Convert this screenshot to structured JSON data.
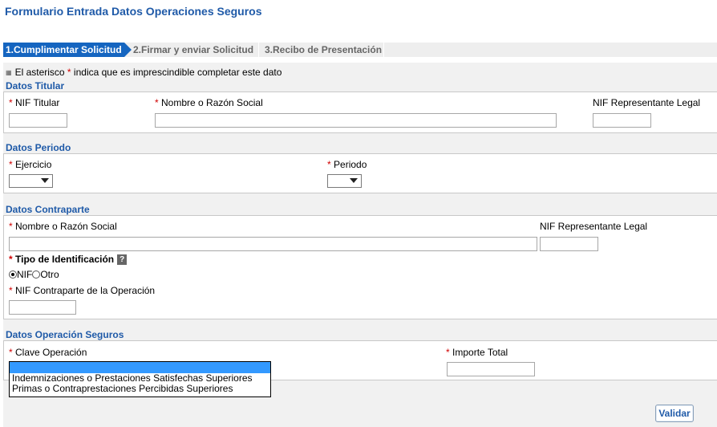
{
  "page": {
    "title": "Formulario Entrada Datos Operaciones Seguros"
  },
  "steps": [
    {
      "label": "1.Cumplimentar Solicitud",
      "active": true
    },
    {
      "label": "2.Firmar y enviar Solicitud",
      "active": false
    },
    {
      "label": "3.Recibo de Presentación",
      "active": false
    }
  ],
  "notice": {
    "prefix": "El asterisco ",
    "asterisk": "*",
    "suffix": " indica que es imprescindible completar este dato"
  },
  "titular": {
    "heading": "Datos Titular",
    "nif_label": "NIF Titular",
    "nombre_label": "Nombre o Razón Social",
    "rep_label": "NIF Representante Legal",
    "nif_value": "",
    "nombre_value": "",
    "rep_value": ""
  },
  "periodo": {
    "heading": "Datos Periodo",
    "ejercicio_label": "Ejercicio",
    "periodo_label": "Periodo",
    "ejercicio_value": "",
    "periodo_value": ""
  },
  "contraparte": {
    "heading": "Datos Contraparte",
    "nombre_label": "Nombre o Razón Social",
    "rep_label": "NIF Representante Legal",
    "tipo_label": "Tipo de Identificación",
    "help_glyph": "?",
    "radio_nif": "NIF",
    "radio_otro": "Otro",
    "selected": "NIF",
    "nif_op_label": "NIF Contraparte de la Operación"
  },
  "operacion": {
    "heading": "Datos Operación Seguros",
    "clave_label": "Clave Operación",
    "importe_label": "Importe Total",
    "options": [
      "Indemnizaciones o Prestaciones Satisfechas Superiores",
      "Primas o Contraprestaciones Percibidas Superiores"
    ]
  },
  "actions": {
    "validar_label": "Validar"
  },
  "colors": {
    "heading": "#1f5aa8",
    "step_active": "#1565c0",
    "required": "#d00000",
    "highlight": "#3399ff"
  }
}
